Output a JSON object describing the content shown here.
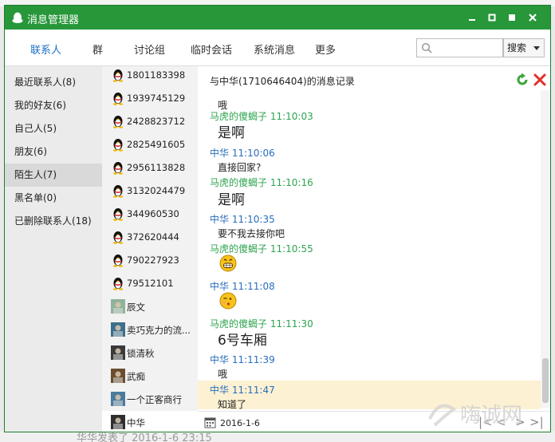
{
  "window": {
    "title": "消息管理器"
  },
  "background": {
    "bottom_text": "华华发表了 2016-1-6 23:15"
  },
  "tabs": [
    {
      "label": "联系人",
      "active": true
    },
    {
      "label": "群"
    },
    {
      "label": "讨论组"
    },
    {
      "label": "临时会话"
    },
    {
      "label": "系统消息"
    },
    {
      "label": "更多"
    }
  ],
  "search": {
    "placeholder": "",
    "button_label": "搜索"
  },
  "categories": [
    {
      "label": "最近联系人(8)"
    },
    {
      "label": "我的好友(6)"
    },
    {
      "label": "自己人(5)"
    },
    {
      "label": "朋友(6)"
    },
    {
      "label": "陌生人(7)",
      "selected": true
    },
    {
      "label": "黑名单(0)"
    },
    {
      "label": "已删除联系人(18)"
    }
  ],
  "contacts": [
    {
      "name": "1801183398",
      "avatar": "penguin-icon"
    },
    {
      "name": "1939745129",
      "avatar": "penguin-icon"
    },
    {
      "name": "2428823712",
      "avatar": "penguin-icon"
    },
    {
      "name": "2825491605",
      "avatar": "penguin-icon"
    },
    {
      "name": "2956113828",
      "avatar": "penguin-icon"
    },
    {
      "name": "3132024479",
      "avatar": "penguin-icon"
    },
    {
      "name": "344960530",
      "avatar": "penguin-icon"
    },
    {
      "name": "372620444",
      "avatar": "penguin-icon"
    },
    {
      "name": "790227923",
      "avatar": "penguin-icon"
    },
    {
      "name": "79512101",
      "avatar": "penguin-icon"
    },
    {
      "name": "辰文",
      "avatar": "photo-avatar"
    },
    {
      "name": "卖巧克力的流...",
      "avatar": "photo-avatar"
    },
    {
      "name": "锁清秋",
      "avatar": "photo-avatar"
    },
    {
      "name": "武痴",
      "avatar": "photo-avatar"
    },
    {
      "name": "一个正客商行",
      "avatar": "photo-avatar"
    },
    {
      "name": "中华",
      "avatar": "photo-avatar",
      "selected": true
    }
  ],
  "pane": {
    "header": "与中华(1710646404)的消息记录",
    "messages": [
      {
        "kind": "text",
        "text": "哦"
      },
      {
        "kind": "meta",
        "who": "other",
        "text": "马虎的傻蝎子 11:10:03"
      },
      {
        "kind": "big",
        "text": "是啊"
      },
      {
        "kind": "meta",
        "who": "me",
        "text": "中华 11:10:06"
      },
      {
        "kind": "text",
        "text": "直接回家?"
      },
      {
        "kind": "meta",
        "who": "other",
        "text": "马虎的傻蝎子 11:10:16"
      },
      {
        "kind": "big",
        "text": "是啊"
      },
      {
        "kind": "meta",
        "who": "me",
        "text": "中华 11:10:35"
      },
      {
        "kind": "text",
        "text": "要不我去接你吧"
      },
      {
        "kind": "meta",
        "who": "other",
        "text": "马虎的傻蝎子 11:10:55"
      },
      {
        "kind": "emoji",
        "icon": "grin-emoji-icon"
      },
      {
        "kind": "meta",
        "who": "me",
        "text": "中华 11:11:08"
      },
      {
        "kind": "emoji",
        "icon": "wink-emoji-icon"
      },
      {
        "kind": "meta",
        "who": "other",
        "text": "马虎的傻蝎子 11:11:30"
      },
      {
        "kind": "big",
        "text": "6号车厢"
      },
      {
        "kind": "meta",
        "who": "me",
        "text": "中华 11:11:39"
      },
      {
        "kind": "text",
        "text": "哦"
      },
      {
        "kind": "meta",
        "who": "me",
        "text": "中华 11:11:47"
      },
      {
        "kind": "text",
        "text": "知道了"
      }
    ],
    "date": "2016-1-6"
  },
  "colors": {
    "titlebar": "#27973a",
    "accent": "#1a6fc4",
    "other_sender": "#2ea44f",
    "me_sender": "#2a6ebb",
    "highlight": "#fdf1d3"
  },
  "watermark": {
    "text": "嗨诚网"
  }
}
